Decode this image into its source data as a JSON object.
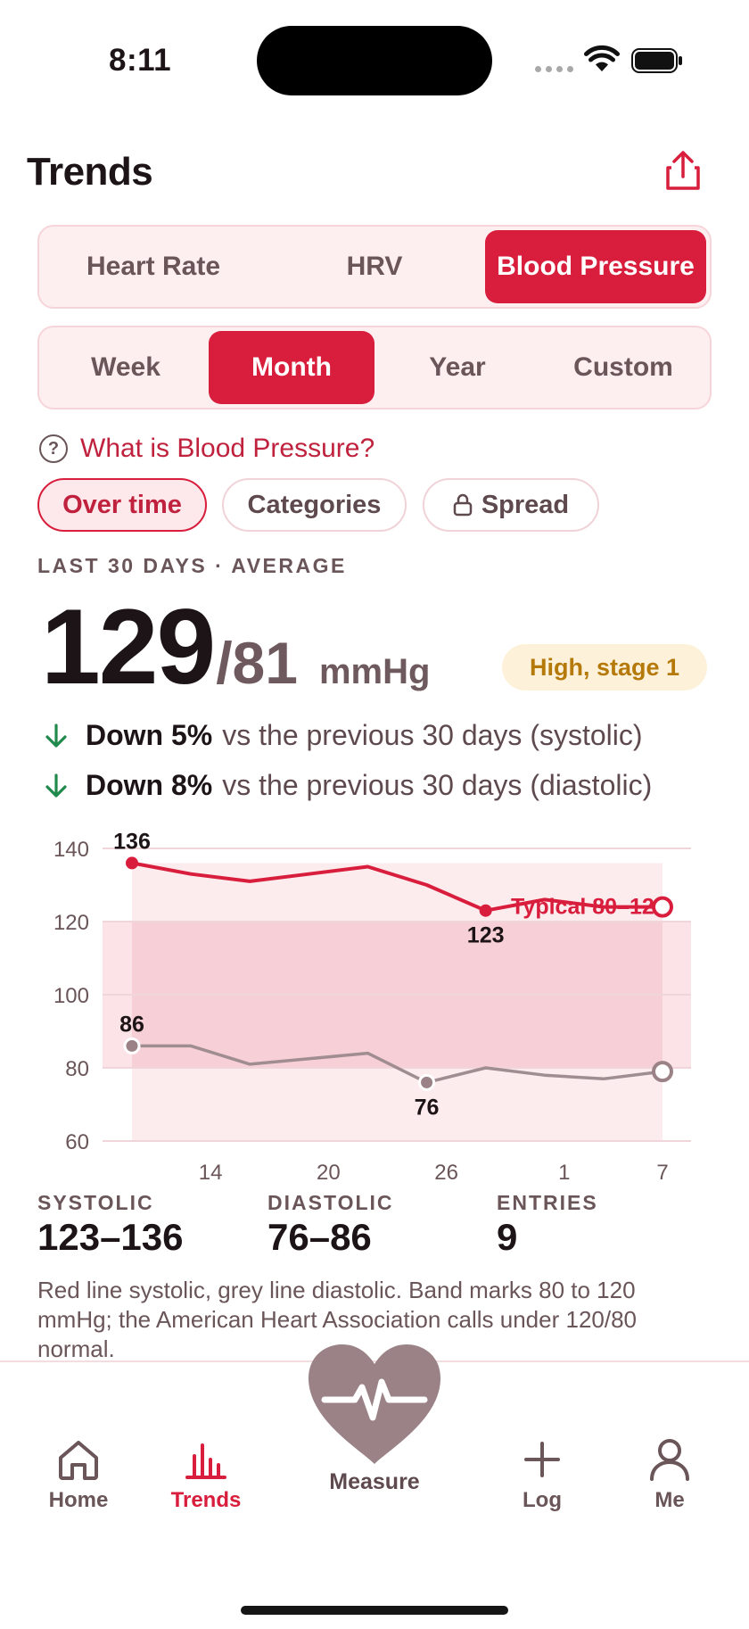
{
  "status_bar": {
    "time": "8:11"
  },
  "header": {
    "title": "Trends"
  },
  "metric_tabs": [
    "Heart Rate",
    "HRV",
    "Blood Pressure"
  ],
  "metric_selected": "Blood Pressure",
  "range_tabs": [
    "Week",
    "Month",
    "Year",
    "Custom"
  ],
  "range_selected": "Month",
  "info_link": "What is Blood Pressure?",
  "view_chips": [
    "Over time",
    "Categories",
    "Spread"
  ],
  "view_selected": "Over time",
  "summary": {
    "period_label": "LAST 30 DAYS · AVERAGE",
    "systolic": "129",
    "diastolic": "/81",
    "unit": "mmHg",
    "category_badge": "High, stage 1"
  },
  "trends": [
    {
      "bold": "Down 5%",
      "rest": "vs the previous 30 days (systolic)"
    },
    {
      "bold": "Down 8%",
      "rest": "vs the previous 30 days (diastolic)"
    }
  ],
  "chart_data": {
    "type": "line",
    "x_ticks": [
      "14",
      "20",
      "26",
      "1",
      "7"
    ],
    "y_ticks": [
      140,
      120,
      100,
      80,
      60
    ],
    "ylim": [
      60,
      140
    ],
    "band": {
      "from": 80,
      "to": 120,
      "label": "Typical 80–120"
    },
    "x": [
      0,
      3,
      6,
      9,
      12,
      15,
      18,
      21,
      24,
      27
    ],
    "series": [
      {
        "values": [
          136,
          133,
          131,
          133,
          135,
          130,
          123,
          126,
          124,
          124
        ],
        "color": "#d81e3c"
      },
      {
        "values": [
          86,
          86,
          81,
          82.5,
          84,
          76,
          80,
          78,
          77,
          79
        ],
        "color": "#a08d91"
      }
    ],
    "point_labels": [
      {
        "series": 0,
        "index": 0,
        "text": "136"
      },
      {
        "series": 0,
        "index": 6,
        "text": "123"
      },
      {
        "series": 1,
        "index": 0,
        "text": "86"
      },
      {
        "series": 1,
        "index": 5,
        "text": "76"
      }
    ]
  },
  "stats": [
    {
      "label": "SYSTOLIC",
      "value": "123–136"
    },
    {
      "label": "DIASTOLIC",
      "value": "76–86"
    },
    {
      "label": "ENTRIES",
      "value": "9"
    }
  ],
  "caption": "Red line systolic, grey line diastolic. Band marks 80 to 120 mmHg; the American Heart Association calls under 120/80 normal.",
  "tabbar": {
    "home": "Home",
    "trends": "Trends",
    "measure": "Measure",
    "log": "Log",
    "me": "Me"
  },
  "colors": {
    "accent": "#d81e3c",
    "badge_text": "#b5790a",
    "trend_arrow": "#1f8a4c"
  }
}
